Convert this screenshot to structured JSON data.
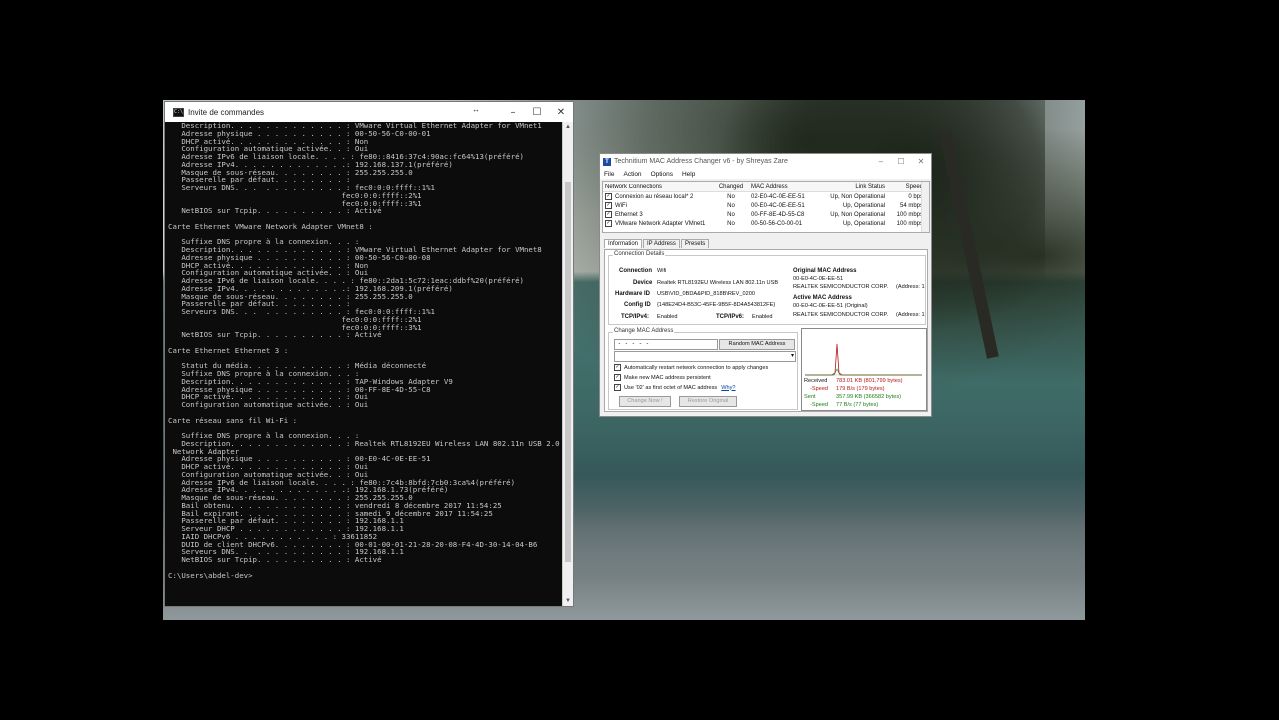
{
  "cmd": {
    "title": "Invite de commandes",
    "icon": "cmd-icon",
    "lines": [
      "   Description. . . . . . . . . . . . . : VMware Virtual Ethernet Adapter for VMnet1",
      "   Adresse physique . . . . . . . . . . : 00-50-56-C0-00-01",
      "   DHCP activé. . . . . . . . . . . . . : Non",
      "   Configuration automatique activée. . : Oui",
      "   Adresse IPv6 de liaison locale. . . . : fe80::8416:37c4:90ac:fc64%13(préféré)",
      "   Adresse IPv4. . . . . . . . . . . . .: 192.168.137.1(préféré)",
      "   Masque de sous-réseau. . . . . . . . : 255.255.255.0",
      "   Passerelle par défaut. . . . . . . . :",
      "   Serveurs DNS. . .  . . . . . . . . . : fec0:0:0:ffff::1%1",
      "                                       fec0:0:0:ffff::2%1",
      "                                       fec0:0:0:ffff::3%1",
      "   NetBIOS sur Tcpip. . . . . . . . . . : Activé",
      "",
      "Carte Ethernet VMware Network Adapter VMnet8 :",
      "",
      "   Suffixe DNS propre à la connexion. . . :",
      "   Description. . . . . . . . . . . . . : VMware Virtual Ethernet Adapter for VMnet8",
      "   Adresse physique . . . . . . . . . . : 00-50-56-C0-00-08",
      "   DHCP activé. . . . . . . . . . . . . : Non",
      "   Configuration automatique activée. . : Oui",
      "   Adresse IPv6 de liaison locale. . . . : fe80::2da1:5c72:1eac:ddbf%20(préféré)",
      "   Adresse IPv4. . . . . . . . . . . . .: 192.168.209.1(préféré)",
      "   Masque de sous-réseau. . . . . . . . : 255.255.255.0",
      "   Passerelle par défaut. . . . . . . . :",
      "   Serveurs DNS. . .  . . . . . . . . . : fec0:0:0:ffff::1%1",
      "                                       fec0:0:0:ffff::2%1",
      "                                       fec0:0:0:ffff::3%1",
      "   NetBIOS sur Tcpip. . . . . . . . . . : Activé",
      "",
      "Carte Ethernet Ethernet 3 :",
      "",
      "   Statut du média. . . . . . . . . . . : Média déconnecté",
      "   Suffixe DNS propre à la connexion. . . :",
      "   Description. . . . . . . . . . . . . : TAP-Windows Adapter V9",
      "   Adresse physique . . . . . . . . . . : 00-FF-8E-4D-55-C8",
      "   DHCP activé. . . . . . . . . . . . . : Oui",
      "   Configuration automatique activée. . : Oui",
      "",
      "Carte réseau sans fil Wi-Fi :",
      "",
      "   Suffixe DNS propre à la connexion. . . :",
      "   Description. . . . . . . . . . . . . : Realtek RTL8192EU Wireless LAN 802.11n USB 2.0",
      " Network Adapter",
      "   Adresse physique . . . . . . . . . . : 00-E0-4C-0E-EE-51",
      "   DHCP activé. . . . . . . . . . . . . : Oui",
      "   Configuration automatique activée. . : Oui",
      "   Adresse IPv6 de liaison locale. . . . : fe80::7c4b:8bfd:7cb0:3ca%4(préféré)",
      "   Adresse IPv4. . . . . . . . . . . . .: 192.168.1.73(préféré)",
      "   Masque de sous-réseau. . . . . . . . : 255.255.255.0",
      "   Bail obtenu. . . . . . . . . . . . . : vendredi 8 décembre 2017 11:54:25",
      "   Bail expirant. . . . . . . . . . . . : samedi 9 décembre 2017 11:54:25",
      "   Passerelle par défaut. . . . . . . . : 192.168.1.1",
      "   Serveur DHCP . . . . . . . . . . . . : 192.168.1.1",
      "   IAID DHCPv6 . . . . . . . . . . . : 33611852",
      "   DUID de client DHCPv6. . . . . . . . : 00-01-00-01-21-28-20-08-F4-4D-30-14-04-B6",
      "   Serveurs DNS. .  . . . . . . . . . . : 192.168.1.1",
      "   NetBIOS sur Tcpip. . . . . . . . . . : Activé",
      "",
      "C:\\Users\\abdel-dev>"
    ]
  },
  "tmac": {
    "title": "Technitium MAC Address Changer v6 - by Shreyas Zare",
    "menu": [
      "File",
      "Action",
      "Options",
      "Help"
    ],
    "columns": [
      "Network Connections",
      "Changed",
      "MAC Address",
      "Link Status",
      "Speed"
    ],
    "rows": [
      {
        "name": "Connexion au réseau local* 2",
        "changed": "No",
        "mac": "02-E0-4C-0E-EE-51",
        "status": "Up, Non Operational",
        "speed": "0 bps",
        "checked": true
      },
      {
        "name": "WiFi",
        "changed": "No",
        "mac": "00-E0-4C-0E-EE-51",
        "status": "Up, Operational",
        "speed": "54 mbps",
        "checked": true
      },
      {
        "name": "Ethernet 3",
        "changed": "No",
        "mac": "00-FF-8E-4D-55-C8",
        "status": "Up, Non Operational",
        "speed": "100 mbps",
        "checked": true
      },
      {
        "name": "VMware Network Adapter VMnet1",
        "changed": "No",
        "mac": "00-50-56-C0-00-01",
        "status": "Up, Operational",
        "speed": "100 mbps",
        "checked": true
      }
    ],
    "tabs": [
      "Information",
      "IP Address",
      "Presets"
    ],
    "details": {
      "group_label": "Connection Details",
      "connection_label": "Connection",
      "connection_value": "Wifi",
      "device_label": "Device",
      "device_value": "Realtek RTL8192EU Wireless LAN 802.11n USB",
      "hardware_label": "Hardware ID",
      "hardware_value": "USB\\VID_0BDA&PID_818B\\REV_0200",
      "config_label": "Config ID",
      "config_value": "{148E24D4-B53C-45FE-9B5F-8D4A543812FE}",
      "tcp4_label": "TCP/IPv4:",
      "tcp4_value": "Enabled",
      "tcp6_label": "TCP/IPv6:",
      "tcp6_value": "Enabled",
      "orig_mac_label": "Original MAC Address",
      "orig_mac_value": "00-E0-4C-0E-EE-51",
      "orig_vendor": "REALTEK SEMICONDUCTOR CORP.",
      "orig_addr": "(Address: 1",
      "active_mac_label": "Active MAC Address",
      "active_mac_value": "00-E0-4C-0E-EE-51 (Original)",
      "active_vendor": "REALTEK SEMICONDUCTOR CORP.",
      "active_addr": "(Address: 1"
    },
    "change": {
      "group_label": "Change MAC Address",
      "mac_placeholder": "  -   -   -   -   -",
      "random_button": "Random MAC Address",
      "cb1": "Automatically restart network connection to apply changes",
      "cb2": "Make new MAC address persistent",
      "cb3": "Use '02' as first octet of MAC address",
      "why_link": "Why?",
      "change_button": "Change Now !",
      "restore_button": "Restore Original"
    },
    "stats": {
      "received_label": "Received",
      "received_value": "783.01 KB (801,799 bytes)",
      "rx_speed_label": "-Speed",
      "rx_speed_value": "179 B/s (179 bytes)",
      "sent_label": "Sent",
      "sent_value": "357.99 KB (366582 bytes)",
      "tx_speed_label": "-Speed",
      "tx_speed_value": "77 B/s (77 bytes)",
      "received_color": "#b01818",
      "sent_color": "#188018"
    }
  }
}
